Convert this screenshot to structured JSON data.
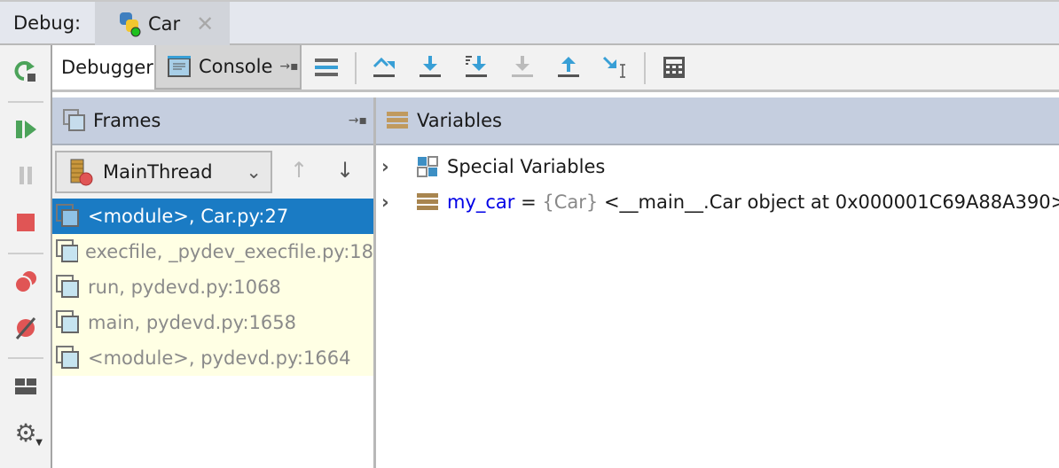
{
  "topbar": {
    "label": "Debug:",
    "tab": "Car"
  },
  "tabs": {
    "debugger": "Debugger",
    "console": "Console"
  },
  "frames": {
    "title": "Frames",
    "thread": "MainThread",
    "items": [
      "<module>, Car.py:27",
      "execfile, _pydev_execfile.py:18",
      "run, pydevd.py:1068",
      "main, pydevd.py:1658",
      "<module>, pydevd.py:1664"
    ]
  },
  "variables": {
    "title": "Variables",
    "special": "Special Variables",
    "my_car": {
      "name": "my_car",
      "eq": " = ",
      "type": "{Car}",
      "value": " <__main__.Car object at 0x000001C69A88A390>"
    }
  },
  "colors": {
    "selection": "#1a7bc4",
    "header": "#c5cedf",
    "accent": "#389fd6"
  }
}
